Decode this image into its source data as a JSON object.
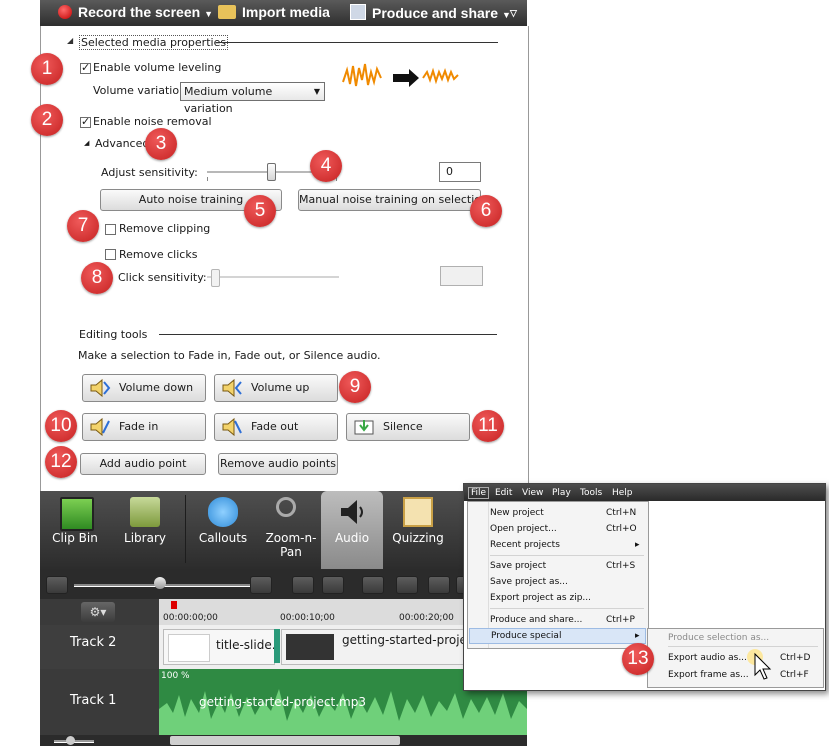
{
  "toolbar": {
    "record": "Record the screen",
    "import": "Import media",
    "produce": "Produce and share"
  },
  "section": {
    "title": "Selected media properties"
  },
  "volume": {
    "leveling_label": "Enable volume leveling",
    "leveling_checked": true,
    "variation_label": "Volume variation:",
    "variation_value": "Medium volume variation"
  },
  "noise": {
    "removal_label": "Enable noise removal",
    "removal_checked": true,
    "advanced_label": "Advanced",
    "sensitivity_label": "Adjust sensitivity:",
    "sensitivity_value": "0",
    "auto_button": "Auto noise training",
    "manual_button": "Manual noise training on selection"
  },
  "clipping": {
    "label": "Remove clipping",
    "checked": false
  },
  "clicks": {
    "label": "Remove clicks",
    "checked": false,
    "sensitivity_label": "Click sensitivity:",
    "sensitivity_value": ""
  },
  "editing": {
    "title": "Editing tools",
    "hint": "Make a selection to Fade in, Fade out, or Silence audio.",
    "volume_down": "Volume down",
    "volume_up": "Volume up",
    "fade_in": "Fade in",
    "fade_out": "Fade out",
    "silence": "Silence",
    "add_point": "Add audio point",
    "remove_points": "Remove audio points"
  },
  "badges": [
    "1",
    "2",
    "3",
    "4",
    "5",
    "6",
    "7",
    "8",
    "9",
    "10",
    "11",
    "12",
    "13"
  ],
  "tabs": [
    {
      "label": "Clip Bin"
    },
    {
      "label": "Library"
    },
    {
      "label": "Callouts"
    },
    {
      "label": "Zoom-n-\nPan"
    },
    {
      "label": "Audio"
    },
    {
      "label": "Quizzing"
    }
  ],
  "timeline": {
    "timecodes": [
      "00:00:00;00",
      "00:00:10;00",
      "00:00:20;00"
    ],
    "track2": "Track 2",
    "track1": "Track 1",
    "clip_title": "title-slide.j",
    "clip_video": "getting-started-project",
    "clip_audio": "getting-started-project.mp3",
    "volume_pct": "100 %"
  },
  "menu": {
    "bar": [
      "File",
      "Edit",
      "View",
      "Play",
      "Tools",
      "Help"
    ],
    "items": [
      {
        "label": "New project",
        "shortcut": "Ctrl+N"
      },
      {
        "label": "Open project...",
        "shortcut": "Ctrl+O"
      },
      {
        "label": "Recent projects",
        "shortcut": "▸"
      },
      {
        "label": "Save project",
        "shortcut": "Ctrl+S"
      },
      {
        "label": "Save project as...",
        "shortcut": ""
      },
      {
        "label": "Export project as zip...",
        "shortcut": ""
      },
      {
        "label": "Produce and share...",
        "shortcut": "Ctrl+P"
      },
      {
        "label": "Produce special",
        "shortcut": "▸"
      }
    ],
    "submenu": [
      {
        "label": "Produce selection as...",
        "shortcut": ""
      },
      {
        "label": "Export audio as...",
        "shortcut": "Ctrl+D"
      },
      {
        "label": "Export frame as...",
        "shortcut": "Ctrl+F"
      }
    ]
  },
  "colors": {
    "badge": "#d32f2f",
    "accent_orange": "#f08a00",
    "wave_green": "#3aa845"
  }
}
